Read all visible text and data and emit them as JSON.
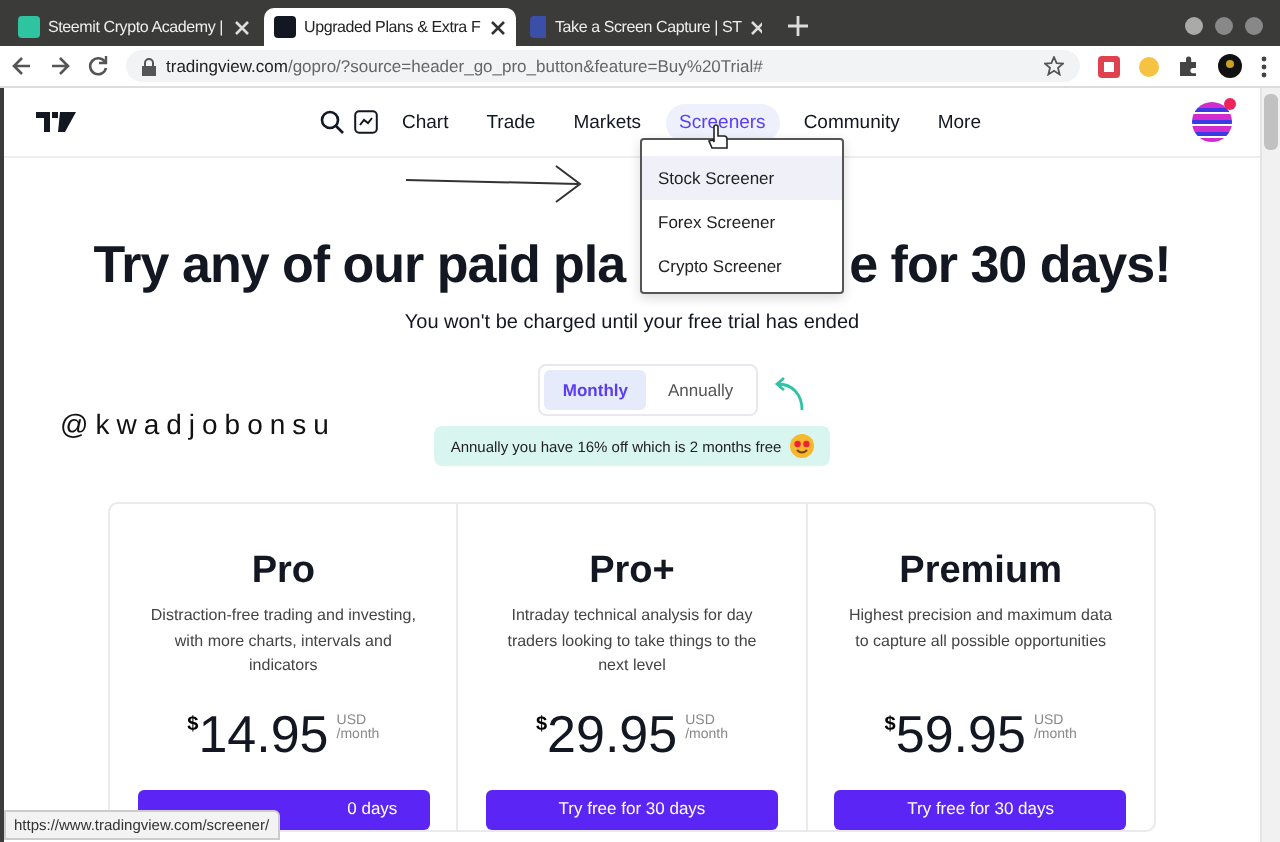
{
  "browser": {
    "tabs": [
      {
        "title": "Steemit Crypto Academy |",
        "selected": false
      },
      {
        "title": "Upgraded Plans & Extra F",
        "selected": true
      },
      {
        "title": "Take a Screen Capture | ST",
        "selected": false
      }
    ],
    "url": {
      "domain": "tradingview.com",
      "path": "/gopro/?source=header_go_pro_button&feature=Buy%20Trial#"
    }
  },
  "nav": {
    "items": [
      {
        "label": "Chart",
        "selected": false
      },
      {
        "label": "Trade",
        "selected": false
      },
      {
        "label": "Markets",
        "selected": false
      },
      {
        "label": "Screeners",
        "selected": true
      },
      {
        "label": "Community",
        "selected": false
      },
      {
        "label": "More",
        "selected": false
      }
    ],
    "dropdown": [
      {
        "label": "Stock Screener",
        "selected": true
      },
      {
        "label": "Forex Screener",
        "selected": false
      },
      {
        "label": "Crypto Screener",
        "selected": false
      }
    ]
  },
  "heading": {
    "left": "Try any of our paid pla",
    "right": "e for 30 days!"
  },
  "subtitle": "You won't be charged until your free trial has ended",
  "billing": [
    {
      "label": "Monthly",
      "selected": true
    },
    {
      "label": "Annually",
      "selected": false
    }
  ],
  "discount_note": "Annually you have 16% off which is 2 months free",
  "annotation_text": "@kwadjobonsu",
  "plans": [
    {
      "name": "Pro",
      "description": "Distraction-free trading and investing, with more charts, intervals and indicators",
      "currency": "$",
      "price": "14.95",
      "unit": "USD",
      "period": "/month",
      "button": "0 days"
    },
    {
      "name": "Pro+",
      "description": "Intraday technical analysis for day traders looking to take things to the next level",
      "currency": "$",
      "price": "29.95",
      "unit": "USD",
      "period": "/month",
      "button": "Try free for 30 days"
    },
    {
      "name": "Premium",
      "description": "Highest precision and maximum data to capture all possible opportunities",
      "currency": "$",
      "price": "59.95",
      "unit": "USD",
      "period": "/month",
      "button": "Try free for 30 days"
    }
  ],
  "status_url": "https://www.tradingview.com/screener/"
}
